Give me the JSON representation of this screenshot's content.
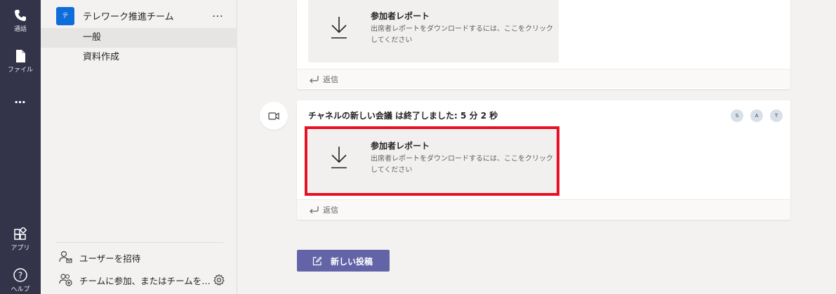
{
  "rail": {
    "calls_label": "通話",
    "files_label": "ファイル",
    "more_label": "…",
    "apps_label": "アプリ",
    "help_label": "ヘルプ"
  },
  "team": {
    "avatar_letter": "テ",
    "name": "テレワーク推進チーム",
    "more": "…",
    "channels": [
      {
        "label": "一般",
        "active": true
      },
      {
        "label": "資料作成",
        "active": false
      }
    ],
    "invite_label": "ユーザーを招待",
    "join_label": "チームに参加、またはチームを…"
  },
  "posts": [
    {
      "report_title": "参加者レポート",
      "report_desc": "出席者レポートをダウンロードするには、ここをクリックしてください",
      "reply_label": "返信"
    },
    {
      "meeting_title": "チャネルの新しい会議 は終了しました: 5 分 2 秒",
      "participants": [
        "S",
        "A",
        "T"
      ],
      "report_title": "参加者レポート",
      "report_desc": "出席者レポートをダウンロードするには、ここをクリックしてください",
      "reply_label": "返信"
    }
  ],
  "new_post_label": "新しい投稿",
  "colors": {
    "rail": "#33344a",
    "accent": "#6264a7",
    "team_avatar": "#0f6cdb",
    "highlight": "#e81123"
  }
}
